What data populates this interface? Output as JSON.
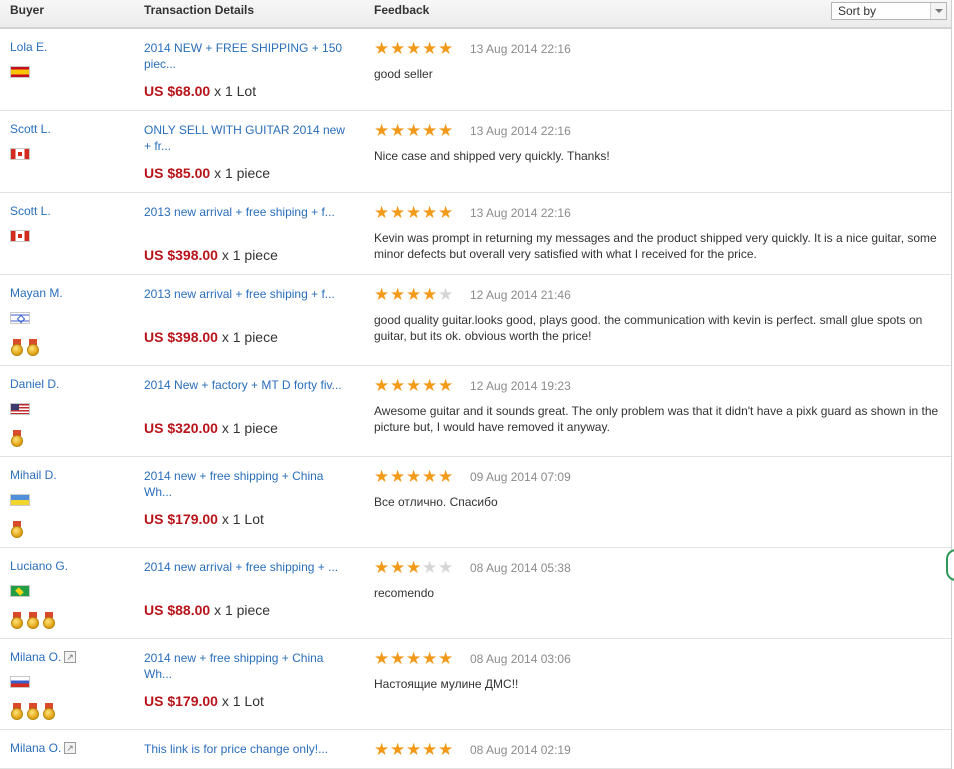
{
  "header": {
    "buyer": "Buyer",
    "transaction": "Transaction Details",
    "feedback": "Feedback",
    "sort_by": "Sort by"
  },
  "colors": {
    "price": "#b8141a",
    "link": "#2a6ebb",
    "star": "#f39a1b",
    "date": "#8b8b8b"
  },
  "rows": [
    {
      "buyer": "Lola E.",
      "flag": "spain-flag-icon",
      "medals": 0,
      "verified": false,
      "title": "2014 NEW + FREE SHIPPING + 150 piec...",
      "price": "US $68.00",
      "qty": "x 1 Lot",
      "rating": 5,
      "date": "13 Aug 2014 22:16",
      "feedback": "good seller"
    },
    {
      "buyer": "Scott L.",
      "flag": "canada-flag-icon",
      "medals": 0,
      "verified": false,
      "title": "ONLY SELL WITH GUITAR 2014 new + fr...",
      "price": "US $85.00",
      "qty": "x 1 piece",
      "rating": 5,
      "date": "13 Aug 2014 22:16",
      "feedback": "Nice case and shipped very quickly. Thanks!"
    },
    {
      "buyer": "Scott L.",
      "flag": "canada-flag-icon",
      "medals": 0,
      "verified": false,
      "title": "2013 new arrival + free shiping + f...",
      "price": "US $398.00",
      "qty": "x 1 piece",
      "rating": 5,
      "date": "13 Aug 2014 22:16",
      "feedback": "Kevin was prompt in returning my messages and the product shipped very quickly. It is a nice guitar, some minor defects but overall very satisfied with what I received for the price."
    },
    {
      "buyer": "Mayan M.",
      "flag": "israel-flag-icon",
      "medals": 2,
      "verified": false,
      "title": "2013 new arrival + free shiping + f...",
      "price": "US $398.00",
      "qty": "x 1 piece",
      "rating": 4,
      "date": "12 Aug 2014 21:46",
      "feedback": "good quality guitar.looks good, plays good. the communication with kevin is perfect. small glue spots on guitar, but its ok. obvious worth the price!"
    },
    {
      "buyer": "Daniel D.",
      "flag": "usa-flag-icon",
      "medals": 1,
      "verified": false,
      "title": "2014 New + factory + MT D forty fiv...",
      "price": "US $320.00",
      "qty": "x 1 piece",
      "rating": 5,
      "date": "12 Aug 2014 19:23",
      "feedback": "Awesome guitar and it sounds great. The only problem was that it didn't have a pixk guard as shown in the picture but, I would have removed it anyway."
    },
    {
      "buyer": "Mihail D.",
      "flag": "ukraine-flag-icon",
      "medals": 1,
      "verified": false,
      "title": "2014 new + free shipping + China Wh...",
      "price": "US $179.00",
      "qty": "x 1 Lot",
      "rating": 5,
      "date": "09 Aug 2014 07:09",
      "feedback": "Все отлично. Спасибо"
    },
    {
      "buyer": "Luciano G.",
      "flag": "brazil-flag-icon",
      "medals": 3,
      "verified": false,
      "title": "2014 new arrival + free shipping + ...",
      "price": "US $88.00",
      "qty": "x 1 piece",
      "rating": 3,
      "date": "08 Aug 2014 05:38",
      "feedback": "recomendo"
    },
    {
      "buyer": "Milana O.",
      "flag": "russia-flag-icon",
      "medals": 3,
      "verified": true,
      "title": "2014 new + free shipping + China Wh...",
      "price": "US $179.00",
      "qty": "x 1 Lot",
      "rating": 5,
      "date": "08 Aug 2014 03:06",
      "feedback": "Настоящие мулине ДМС!!"
    },
    {
      "buyer": "Milana O.",
      "flag": "russia-flag-icon",
      "medals": 0,
      "verified": true,
      "title": "This link is for price change only!...",
      "price": "",
      "qty": "",
      "rating": 5,
      "date": "08 Aug 2014 02:19",
      "feedback": ""
    }
  ]
}
